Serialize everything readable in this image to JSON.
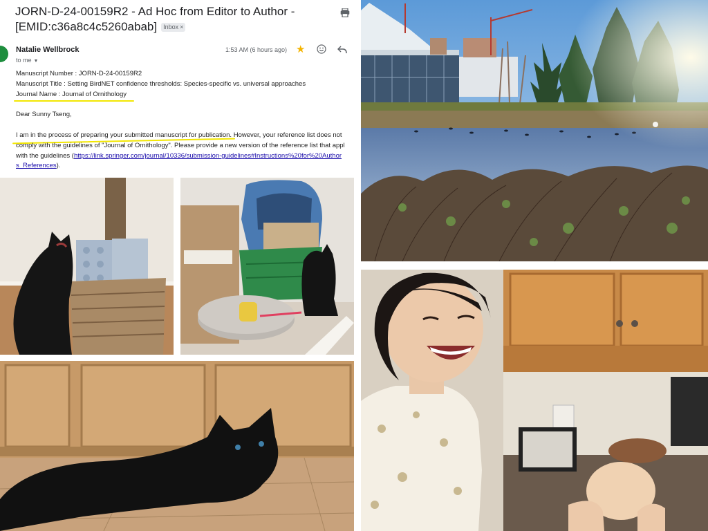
{
  "email": {
    "subject": "JORN-D-24-00159R2 - Ad Hoc from Editor to Author - [EMID:c36a8c4c5260abab]",
    "label_chip": "Inbox",
    "label_chip_close": "×",
    "sender": "Natalie Wellbrock",
    "recipient": "to me",
    "timestamp": "1:53 AM (6 hours ago)",
    "lines": {
      "manuscript_number": "Manuscript Number : JORN-D-24-00159R2",
      "manuscript_title": "Manuscript Title : Setting BirdNET confidence thresholds: Species-specific vs. universal approaches",
      "journal_name": "Journal Name : Journal of Ornithology",
      "greeting": "Dear Sunny Tseng,",
      "body_1": "I am in the process of preparing your submitted manuscript for publication. However, your reference list does not",
      "body_2": "comply with the guidelines of \"Journal of Ornithology\". Please provide a new version of the reference list that appl",
      "body_3_prefix": "with the guidelines (",
      "link_1": "https://link.springer.com/journal/10336/submission-guidelines#Instructions%20for%20Author",
      "link_2": "s_References",
      "body_4_suffix": ")."
    },
    "icons": [
      "print-icon",
      "star-icon",
      "emoji-icon",
      "reply-icon",
      "chevron-down-icon"
    ],
    "colors": {
      "highlight": "#f2e600",
      "star": "#f4b400",
      "avatar": "#1e8e3e",
      "link": "#1a0dab"
    }
  },
  "photos": [
    {
      "name": "park-pond-photo",
      "description_icon": "landscape"
    },
    {
      "name": "black-cat-with-basket-photo",
      "description_icon": "cat"
    },
    {
      "name": "black-cat-near-backpack-photo",
      "description_icon": "cat"
    },
    {
      "name": "black-cat-lying-on-floor-photo",
      "description_icon": "cat"
    },
    {
      "name": "woman-laughing-with-dough-photo",
      "description_icon": "person"
    }
  ]
}
